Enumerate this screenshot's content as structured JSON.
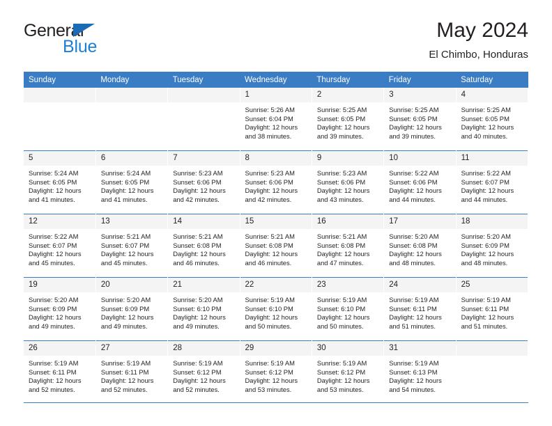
{
  "brand": {
    "name_top": "General",
    "name_bottom": "Blue",
    "accent_color": "#1c7fd4",
    "triangle_color": "#1c6cb5"
  },
  "header": {
    "title": "May 2024",
    "subtitle": "El Chimbo, Honduras",
    "header_bg": "#3b7dc4",
    "daynum_bg": "#f4f4f4"
  },
  "weekdays": [
    "Sunday",
    "Monday",
    "Tuesday",
    "Wednesday",
    "Thursday",
    "Friday",
    "Saturday"
  ],
  "weeks": [
    [
      {
        "day": "",
        "lines": []
      },
      {
        "day": "",
        "lines": []
      },
      {
        "day": "",
        "lines": []
      },
      {
        "day": "1",
        "lines": [
          "Sunrise: 5:26 AM",
          "Sunset: 6:04 PM",
          "Daylight: 12 hours",
          "and 38 minutes."
        ]
      },
      {
        "day": "2",
        "lines": [
          "Sunrise: 5:25 AM",
          "Sunset: 6:05 PM",
          "Daylight: 12 hours",
          "and 39 minutes."
        ]
      },
      {
        "day": "3",
        "lines": [
          "Sunrise: 5:25 AM",
          "Sunset: 6:05 PM",
          "Daylight: 12 hours",
          "and 39 minutes."
        ]
      },
      {
        "day": "4",
        "lines": [
          "Sunrise: 5:25 AM",
          "Sunset: 6:05 PM",
          "Daylight: 12 hours",
          "and 40 minutes."
        ]
      }
    ],
    [
      {
        "day": "5",
        "lines": [
          "Sunrise: 5:24 AM",
          "Sunset: 6:05 PM",
          "Daylight: 12 hours",
          "and 41 minutes."
        ]
      },
      {
        "day": "6",
        "lines": [
          "Sunrise: 5:24 AM",
          "Sunset: 6:05 PM",
          "Daylight: 12 hours",
          "and 41 minutes."
        ]
      },
      {
        "day": "7",
        "lines": [
          "Sunrise: 5:23 AM",
          "Sunset: 6:06 PM",
          "Daylight: 12 hours",
          "and 42 minutes."
        ]
      },
      {
        "day": "8",
        "lines": [
          "Sunrise: 5:23 AM",
          "Sunset: 6:06 PM",
          "Daylight: 12 hours",
          "and 42 minutes."
        ]
      },
      {
        "day": "9",
        "lines": [
          "Sunrise: 5:23 AM",
          "Sunset: 6:06 PM",
          "Daylight: 12 hours",
          "and 43 minutes."
        ]
      },
      {
        "day": "10",
        "lines": [
          "Sunrise: 5:22 AM",
          "Sunset: 6:06 PM",
          "Daylight: 12 hours",
          "and 44 minutes."
        ]
      },
      {
        "day": "11",
        "lines": [
          "Sunrise: 5:22 AM",
          "Sunset: 6:07 PM",
          "Daylight: 12 hours",
          "and 44 minutes."
        ]
      }
    ],
    [
      {
        "day": "12",
        "lines": [
          "Sunrise: 5:22 AM",
          "Sunset: 6:07 PM",
          "Daylight: 12 hours",
          "and 45 minutes."
        ]
      },
      {
        "day": "13",
        "lines": [
          "Sunrise: 5:21 AM",
          "Sunset: 6:07 PM",
          "Daylight: 12 hours",
          "and 45 minutes."
        ]
      },
      {
        "day": "14",
        "lines": [
          "Sunrise: 5:21 AM",
          "Sunset: 6:08 PM",
          "Daylight: 12 hours",
          "and 46 minutes."
        ]
      },
      {
        "day": "15",
        "lines": [
          "Sunrise: 5:21 AM",
          "Sunset: 6:08 PM",
          "Daylight: 12 hours",
          "and 46 minutes."
        ]
      },
      {
        "day": "16",
        "lines": [
          "Sunrise: 5:21 AM",
          "Sunset: 6:08 PM",
          "Daylight: 12 hours",
          "and 47 minutes."
        ]
      },
      {
        "day": "17",
        "lines": [
          "Sunrise: 5:20 AM",
          "Sunset: 6:08 PM",
          "Daylight: 12 hours",
          "and 48 minutes."
        ]
      },
      {
        "day": "18",
        "lines": [
          "Sunrise: 5:20 AM",
          "Sunset: 6:09 PM",
          "Daylight: 12 hours",
          "and 48 minutes."
        ]
      }
    ],
    [
      {
        "day": "19",
        "lines": [
          "Sunrise: 5:20 AM",
          "Sunset: 6:09 PM",
          "Daylight: 12 hours",
          "and 49 minutes."
        ]
      },
      {
        "day": "20",
        "lines": [
          "Sunrise: 5:20 AM",
          "Sunset: 6:09 PM",
          "Daylight: 12 hours",
          "and 49 minutes."
        ]
      },
      {
        "day": "21",
        "lines": [
          "Sunrise: 5:20 AM",
          "Sunset: 6:10 PM",
          "Daylight: 12 hours",
          "and 49 minutes."
        ]
      },
      {
        "day": "22",
        "lines": [
          "Sunrise: 5:19 AM",
          "Sunset: 6:10 PM",
          "Daylight: 12 hours",
          "and 50 minutes."
        ]
      },
      {
        "day": "23",
        "lines": [
          "Sunrise: 5:19 AM",
          "Sunset: 6:10 PM",
          "Daylight: 12 hours",
          "and 50 minutes."
        ]
      },
      {
        "day": "24",
        "lines": [
          "Sunrise: 5:19 AM",
          "Sunset: 6:11 PM",
          "Daylight: 12 hours",
          "and 51 minutes."
        ]
      },
      {
        "day": "25",
        "lines": [
          "Sunrise: 5:19 AM",
          "Sunset: 6:11 PM",
          "Daylight: 12 hours",
          "and 51 minutes."
        ]
      }
    ],
    [
      {
        "day": "26",
        "lines": [
          "Sunrise: 5:19 AM",
          "Sunset: 6:11 PM",
          "Daylight: 12 hours",
          "and 52 minutes."
        ]
      },
      {
        "day": "27",
        "lines": [
          "Sunrise: 5:19 AM",
          "Sunset: 6:11 PM",
          "Daylight: 12 hours",
          "and 52 minutes."
        ]
      },
      {
        "day": "28",
        "lines": [
          "Sunrise: 5:19 AM",
          "Sunset: 6:12 PM",
          "Daylight: 12 hours",
          "and 52 minutes."
        ]
      },
      {
        "day": "29",
        "lines": [
          "Sunrise: 5:19 AM",
          "Sunset: 6:12 PM",
          "Daylight: 12 hours",
          "and 53 minutes."
        ]
      },
      {
        "day": "30",
        "lines": [
          "Sunrise: 5:19 AM",
          "Sunset: 6:12 PM",
          "Daylight: 12 hours",
          "and 53 minutes."
        ]
      },
      {
        "day": "31",
        "lines": [
          "Sunrise: 5:19 AM",
          "Sunset: 6:13 PM",
          "Daylight: 12 hours",
          "and 54 minutes."
        ]
      },
      {
        "day": "",
        "lines": []
      }
    ]
  ]
}
